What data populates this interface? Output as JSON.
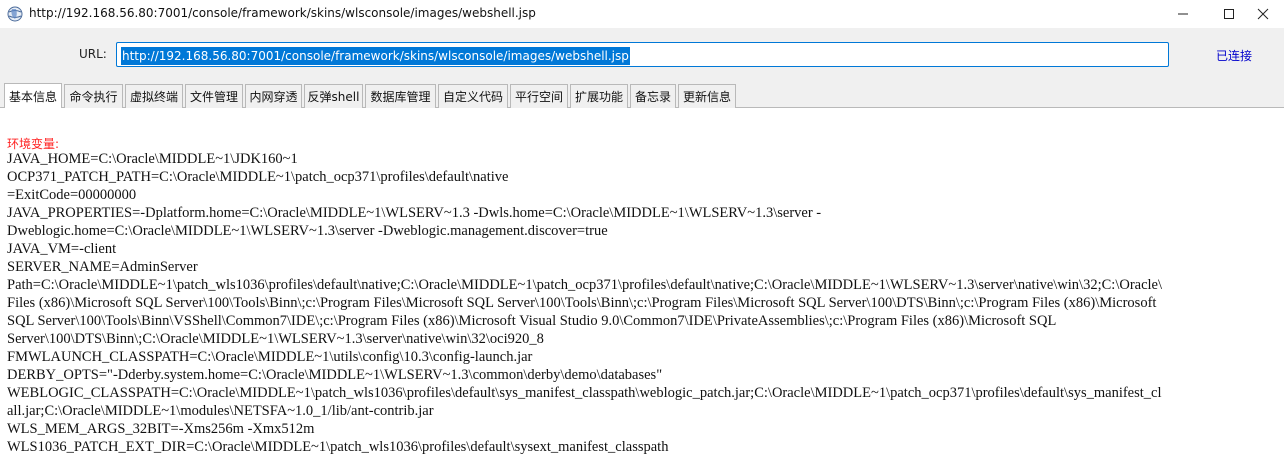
{
  "window": {
    "title": "http://192.168.56.80:7001/console/framework/skins/wlsconsole/images/webshell.jsp",
    "app_icon": "globe-icon",
    "controls": [
      "minimize-icon",
      "maximize-icon",
      "close-icon"
    ]
  },
  "urlbar": {
    "label": "URL:",
    "value": "http://192.168.56.80:7001/console/framework/skins/wlsconsole/images/webshell.jsp",
    "status": "已连接"
  },
  "tabs": [
    {
      "label": "基本信息",
      "active": true
    },
    {
      "label": "命令执行"
    },
    {
      "label": "虚拟终端"
    },
    {
      "label": "文件管理"
    },
    {
      "label": "内网穿透"
    },
    {
      "label": "反弹shell"
    },
    {
      "label": "数据库管理"
    },
    {
      "label": "自定义代码"
    },
    {
      "label": "平行空间"
    },
    {
      "label": "扩展功能"
    },
    {
      "label": "备忘录"
    },
    {
      "label": "更新信息"
    }
  ],
  "content": {
    "env_header": "环境变量:",
    "lines": [
      "JAVA_HOME=C:\\Oracle\\MIDDLE~1\\JDK160~1",
      "OCP371_PATCH_PATH=C:\\Oracle\\MIDDLE~1\\patch_ocp371\\profiles\\default\\native",
      "=ExitCode=00000000",
      "JAVA_PROPERTIES=-Dplatform.home=C:\\Oracle\\MIDDLE~1\\WLSERV~1.3 -Dwls.home=C:\\Oracle\\MIDDLE~1\\WLSERV~1.3\\server -",
      "Dweblogic.home=C:\\Oracle\\MIDDLE~1\\WLSERV~1.3\\server -Dweblogic.management.discover=true",
      "JAVA_VM=-client",
      "SERVER_NAME=AdminServer",
      "Path=C:\\Oracle\\MIDDLE~1\\patch_wls1036\\profiles\\default\\native;C:\\Oracle\\MIDDLE~1\\patch_ocp371\\profiles\\default\\native;C:\\Oracle\\MIDDLE~1\\WLSERV~1.3\\server\\native\\win\\32;C:\\Oracle\\",
      "Files (x86)\\Microsoft SQL Server\\100\\Tools\\Binn\\;c:\\Program Files\\Microsoft SQL Server\\100\\Tools\\Binn\\;c:\\Program Files\\Microsoft SQL Server\\100\\DTS\\Binn\\;c:\\Program Files (x86)\\Microsoft",
      "SQL Server\\100\\Tools\\Binn\\VSShell\\Common7\\IDE\\;c:\\Program Files (x86)\\Microsoft Visual Studio 9.0\\Common7\\IDE\\PrivateAssemblies\\;c:\\Program Files (x86)\\Microsoft SQL",
      "Server\\100\\DTS\\Binn\\;C:\\Oracle\\MIDDLE~1\\WLSERV~1.3\\server\\native\\win\\32\\oci920_8",
      "FMWLAUNCH_CLASSPATH=C:\\Oracle\\MIDDLE~1\\utils\\config\\10.3\\config-launch.jar",
      "DERBY_OPTS=\"-Dderby.system.home=C:\\Oracle\\MIDDLE~1\\WLSERV~1.3\\common\\derby\\demo\\databases\"",
      "WEBLOGIC_CLASSPATH=C:\\Oracle\\MIDDLE~1\\patch_wls1036\\profiles\\default\\sys_manifest_classpath\\weblogic_patch.jar;C:\\Oracle\\MIDDLE~1\\patch_ocp371\\profiles\\default\\sys_manifest_cl",
      "all.jar;C:\\Oracle\\MIDDLE~1\\modules\\NETSFA~1.0_1/lib/ant-contrib.jar",
      "WLS_MEM_ARGS_32BIT=-Xms256m -Xmx512m",
      "WLS1036_PATCH_EXT_DIR=C:\\Oracle\\MIDDLE~1\\patch_wls1036\\profiles\\default\\sysext_manifest_classpath"
    ]
  }
}
